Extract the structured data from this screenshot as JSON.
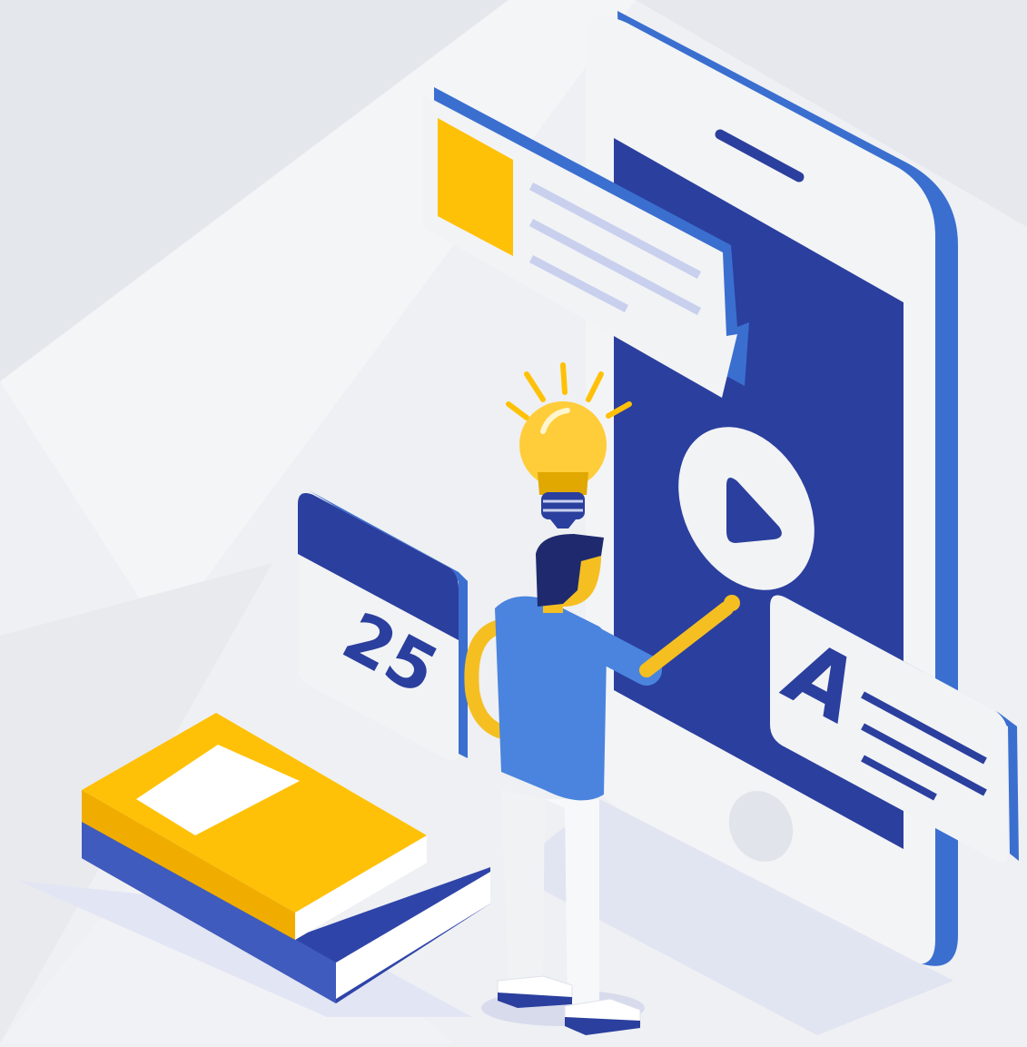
{
  "scene": {
    "title": "",
    "calendar": {
      "day": "25"
    },
    "card": {
      "letter": "A"
    }
  },
  "palette": {
    "background": "#eef0f3",
    "phone_body": "#f3f4f6",
    "phone_edge": "#3a6fd0",
    "screen": "#2b3f9e",
    "yellow": "#ffc107",
    "card_white": "#f2f3f5",
    "text_line_blue": "#2b3f9e",
    "text_line_light": "#c9d0ee",
    "shirt": "#4a84de",
    "hair": "#1f2a6e",
    "skin": "#f5bf22",
    "pants": "#f1f2f4",
    "book_cover_yellow": "#ffc107",
    "book_cover_blue": "#2f44a8"
  },
  "icons": [
    "lightbulb-icon",
    "play-icon",
    "calendar-icon",
    "book-icon",
    "chat-bubble-icon",
    "letter-card-icon"
  ]
}
